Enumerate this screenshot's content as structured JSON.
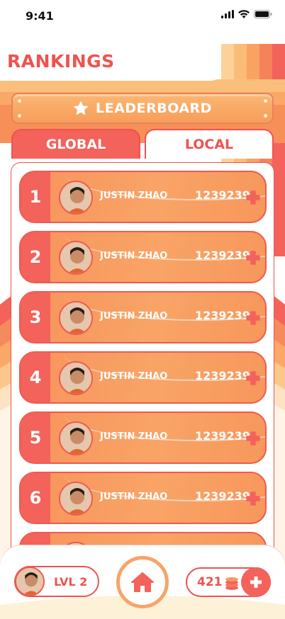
{
  "status_bar": {
    "time": "9:41"
  },
  "header": {
    "title": "RANKINGS"
  },
  "banner": {
    "label": "LEADERBOARD",
    "icon": "star-icon"
  },
  "tabs": [
    {
      "label": "GLOBAL",
      "active": true
    },
    {
      "label": "LOCAL",
      "active": false
    }
  ],
  "rankings": [
    {
      "rank": "1",
      "name": "JUSTIN ZHAO",
      "score": "1239239"
    },
    {
      "rank": "2",
      "name": "JUSTIN ZHAO",
      "score": "1239239"
    },
    {
      "rank": "3",
      "name": "JUSTIN ZHAO",
      "score": "1239239"
    },
    {
      "rank": "4",
      "name": "JUSTIN ZHAO",
      "score": "1239239"
    },
    {
      "rank": "5",
      "name": "JUSTIN ZHAO",
      "score": "1239239"
    },
    {
      "rank": "6",
      "name": "JUSTIN ZHAO",
      "score": "1239239"
    }
  ],
  "bottom_bar": {
    "level_label": "LVL 2",
    "coins": "421",
    "home_icon": "home-icon",
    "coins_icon": "coin-stack-icon",
    "add_icon": "plus-icon"
  },
  "colors": {
    "primary_red": "#f0524e",
    "orange": "#f79d5a",
    "light_orange": "#fbb873"
  }
}
